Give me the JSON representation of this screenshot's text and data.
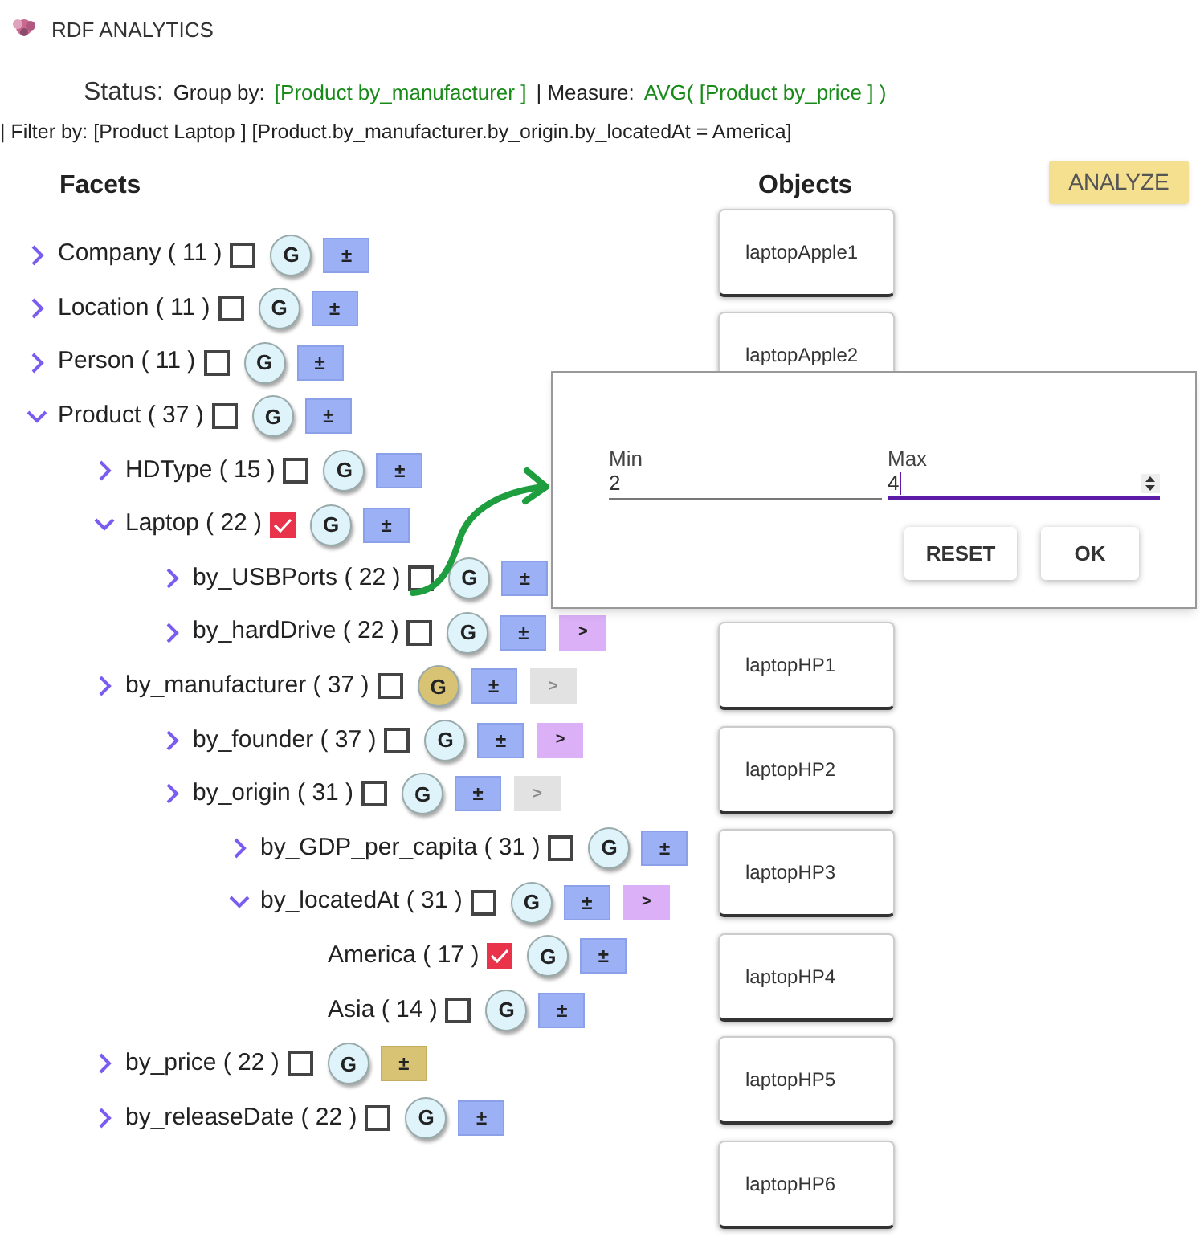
{
  "header": {
    "title": "RDF ANALYTICS"
  },
  "status": {
    "label": "Status:",
    "group_by_label": "Group by:",
    "group_by": "[Product by_manufacturer ]",
    "measure_label": "| Measure:",
    "measure": "AVG( [Product by_price ] )",
    "filter": "| Filter by: [Product Laptop ] [Product.by_manufacturer.by_origin.by_locatedAt = America]"
  },
  "facets": {
    "title": "Facets",
    "tree": [
      {
        "label": "Company ( 11 )",
        "expanded": false,
        "checked": false,
        "group": {
          "label": "G",
          "selected": false
        },
        "range": {
          "label": "±",
          "selected": false
        }
      },
      {
        "label": "Location ( 11 )",
        "expanded": false,
        "checked": false,
        "group": {
          "label": "G",
          "selected": false
        },
        "range": {
          "label": "±",
          "selected": false
        }
      },
      {
        "label": "Person ( 11 )",
        "expanded": false,
        "checked": false,
        "group": {
          "label": "G",
          "selected": false
        },
        "range": {
          "label": "±",
          "selected": false
        }
      },
      {
        "label": "Product ( 37 )",
        "expanded": true,
        "checked": false,
        "group": {
          "label": "G",
          "selected": false
        },
        "range": {
          "label": "±",
          "selected": false
        },
        "children": [
          {
            "label": "HDType ( 15 )",
            "expanded": false,
            "checked": false,
            "group": {
              "label": "G",
              "selected": false
            },
            "range": {
              "label": "±",
              "selected": false
            }
          },
          {
            "label": "Laptop ( 22 )",
            "expanded": true,
            "checked": true,
            "group": {
              "label": "G",
              "selected": false
            },
            "range": {
              "label": "±",
              "selected": false
            },
            "children": [
              {
                "label": "by_USBPorts ( 22 )",
                "expanded": false,
                "checked": false,
                "group": {
                  "label": "G",
                  "selected": false
                },
                "range": {
                  "label": "±",
                  "selected": false
                }
              },
              {
                "label": "by_hardDrive ( 22 )",
                "expanded": false,
                "checked": false,
                "group": {
                  "label": "G",
                  "selected": false
                },
                "range": {
                  "label": "±",
                  "selected": false
                },
                "next": {
                  "label": ">",
                  "disabled": false
                }
              }
            ]
          },
          {
            "label": "by_manufacturer ( 37 )",
            "expanded": false,
            "checked": false,
            "group": {
              "label": "G",
              "selected": true
            },
            "range": {
              "label": "±",
              "selected": false
            },
            "next": {
              "label": ">",
              "disabled": true
            },
            "children": [
              {
                "label": "by_founder ( 37 )",
                "expanded": false,
                "checked": false,
                "group": {
                  "label": "G",
                  "selected": false
                },
                "range": {
                  "label": "±",
                  "selected": false
                },
                "next": {
                  "label": ">",
                  "disabled": false
                }
              },
              {
                "label": "by_origin ( 31 )",
                "expanded": false,
                "checked": false,
                "group": {
                  "label": "G",
                  "selected": false
                },
                "range": {
                  "label": "±",
                  "selected": false
                },
                "next": {
                  "label": ">",
                  "disabled": true
                },
                "children": [
                  {
                    "label": "by_GDP_per_capita ( 31 )",
                    "expanded": false,
                    "checked": false,
                    "group": {
                      "label": "G",
                      "selected": false
                    },
                    "range": {
                      "label": "±",
                      "selected": false
                    }
                  },
                  {
                    "label": "by_locatedAt ( 31 )",
                    "expanded": true,
                    "checked": false,
                    "group": {
                      "label": "G",
                      "selected": false
                    },
                    "range": {
                      "label": "±",
                      "selected": false
                    },
                    "next": {
                      "label": ">",
                      "disabled": false
                    },
                    "children": [
                      {
                        "label": "America ( 17 )",
                        "checked": true,
                        "group": {
                          "label": "G",
                          "selected": false
                        },
                        "range": {
                          "label": "±",
                          "selected": false
                        }
                      },
                      {
                        "label": "Asia ( 14 )",
                        "checked": false,
                        "group": {
                          "label": "G",
                          "selected": false
                        },
                        "range": {
                          "label": "±",
                          "selected": false
                        }
                      }
                    ]
                  }
                ]
              }
            ]
          },
          {
            "label": "by_price ( 22 )",
            "expanded": false,
            "checked": false,
            "group": {
              "label": "G",
              "selected": false
            },
            "range": {
              "label": "±",
              "selected": true
            }
          },
          {
            "label": "by_releaseDate ( 22 )",
            "expanded": false,
            "checked": false,
            "group": {
              "label": "G",
              "selected": false
            },
            "range": {
              "label": "±",
              "selected": false
            }
          }
        ]
      }
    ]
  },
  "objects": {
    "title": "Objects",
    "analyze_button": "ANALYZE",
    "items": [
      "laptopApple1",
      "laptopApple2",
      "laptopHP1",
      "laptopHP2",
      "laptopHP3",
      "laptopHP4",
      "laptopHP5",
      "laptopHP6"
    ]
  },
  "range_dialog": {
    "min": {
      "label": "Min",
      "value": "2",
      "focused": false
    },
    "max": {
      "label": "Max",
      "value": "4",
      "focused": true
    },
    "buttons": [
      "RESET",
      "OK"
    ]
  }
}
